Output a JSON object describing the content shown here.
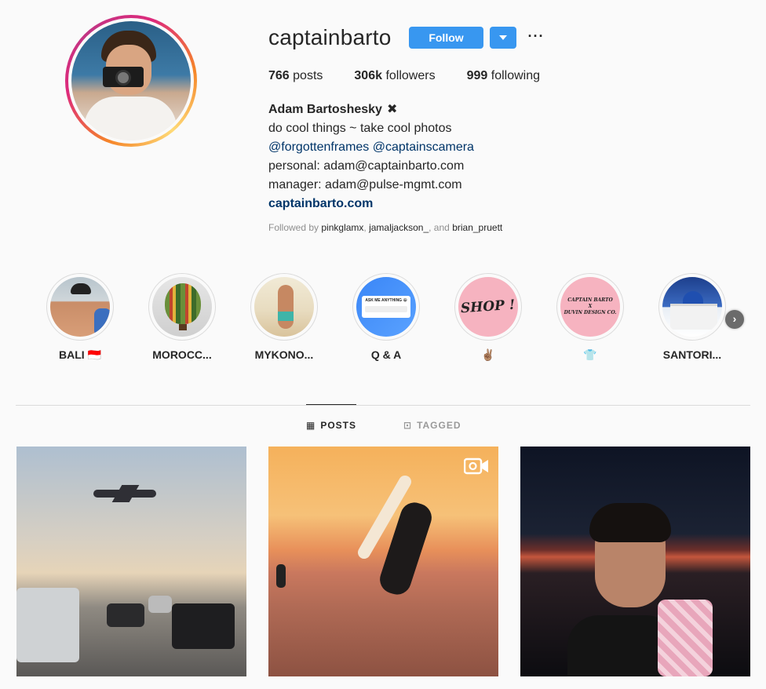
{
  "profile": {
    "username": "captainbarto",
    "follow_label": "Follow",
    "more_label": "···",
    "stats": {
      "posts_count": "766",
      "posts_label": "posts",
      "followers_count": "306k",
      "followers_label": "followers",
      "following_count": "999",
      "following_label": "following"
    },
    "bio": {
      "full_name": "Adam Bartoshesky",
      "name_emoji": "✖",
      "line1": "do cool things ~ take cool photos",
      "mention1": "@forgottenframes",
      "mention2": "@captainscamera",
      "line3": "personal: adam@captainbarto.com",
      "line4": "manager: adam@pulse-mgmt.com",
      "website": "captainbarto.com"
    },
    "followed_by": {
      "prefix": "Followed by",
      "user1": "pinkglamx",
      "sep1": ",",
      "user2": "jamaljackson_",
      "sep2": ", and",
      "user3": "brian_pruett"
    }
  },
  "highlights": [
    {
      "label": "BALI 🇮🇩"
    },
    {
      "label": "MOROCC..."
    },
    {
      "label": "MYKONO..."
    },
    {
      "label": "Q & A",
      "card_title": "ASK ME ANYTHING 😀"
    },
    {
      "label": "✌🏽",
      "card_text": "SHOP !"
    },
    {
      "label": "👕",
      "card_line1": "CAPTAIN BARTO",
      "card_line2": "X",
      "card_line3": "DUVIN DESIGN CO."
    },
    {
      "label": "SANTORI..."
    }
  ],
  "highlights_next": "›",
  "tabs": [
    {
      "label": "POSTS",
      "icon": "▦",
      "active": true
    },
    {
      "label": "TAGGED",
      "icon": "⊡",
      "active": false
    }
  ],
  "posts": [
    {
      "type": "photo",
      "subject": "airplane-over-traffic"
    },
    {
      "type": "video",
      "subject": "surfer-jumping-at-sunset"
    },
    {
      "type": "photo",
      "subject": "portrait-with-towel-at-dusk"
    }
  ],
  "colors": {
    "accent": "#3897f0",
    "link": "#003569",
    "muted": "#8e8e8e",
    "background": "#fafafa"
  }
}
